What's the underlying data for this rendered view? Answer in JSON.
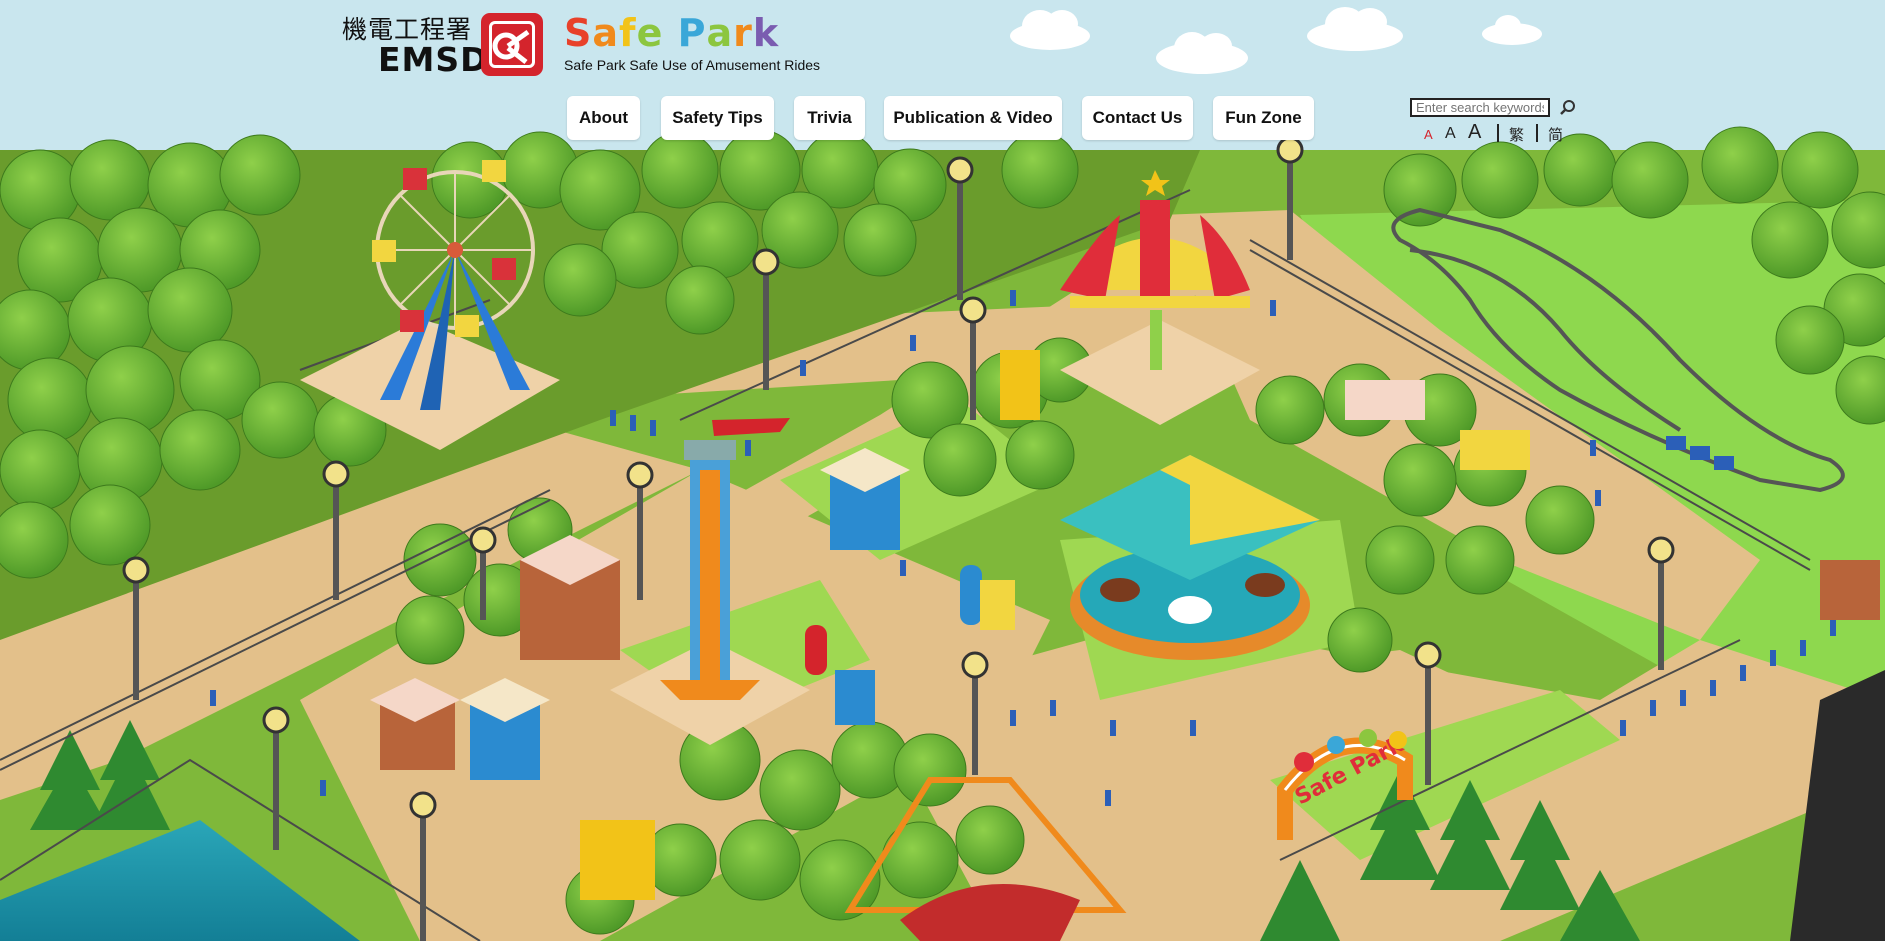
{
  "header": {
    "emsd_chinese": "機電工程署",
    "emsd_english": "EMSD",
    "site_title_letters": [
      "S",
      "a",
      "f",
      "e",
      " ",
      "P",
      "a",
      "r",
      "k"
    ],
    "site_title_colors": [
      "#e8412a",
      "#f08a1c",
      "#f2c318",
      "#8cc63f",
      "#ffffff",
      "#3aa7d8",
      "#8cc63f",
      "#f08a1c",
      "#7a5cb0"
    ],
    "site_subtitle": "Safe Park Safe Use of Amusement Rides"
  },
  "nav": {
    "items": [
      {
        "label": "About"
      },
      {
        "label": "Safety Tips"
      },
      {
        "label": "Trivia"
      },
      {
        "label": "Publication & Video"
      },
      {
        "label": "Contact Us"
      },
      {
        "label": "Fun Zone"
      }
    ]
  },
  "search": {
    "placeholder": "Enter search keywords",
    "icon": "search-icon"
  },
  "font_size": {
    "small": "A",
    "medium": "A",
    "large": "A"
  },
  "language": {
    "traditional": "繁",
    "simplified": "简"
  },
  "scene": {
    "arch_sign": "Safe Park"
  },
  "colors": {
    "sky": "#c9e6ee",
    "grass": "#8fce45",
    "path": "#e3c08a",
    "tree": "#5da52d",
    "emsd_red": "#d4242c"
  }
}
